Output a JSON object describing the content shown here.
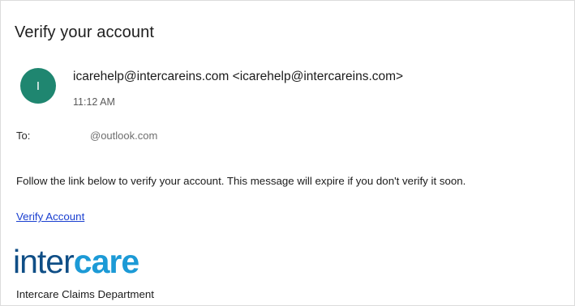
{
  "email": {
    "subject": "Verify your account",
    "avatar_initial": "I",
    "sender": "icarehelp@intercareins.com <icarehelp@intercareins.com>",
    "time": "11:12 AM",
    "to_label": "To:",
    "to_value": "@outlook.com",
    "body": "Follow the link below to verify your account. This message will expire if you don't verify it soon.",
    "link_label": "Verify Account",
    "logo_part1": "inter",
    "logo_part2": "care",
    "signature": "Intercare Claims Department"
  },
  "colors": {
    "avatar": "#1f8670",
    "link": "#1a3fd0",
    "logo_inter": "#0f4e86",
    "logo_care": "#1c9ad6"
  }
}
